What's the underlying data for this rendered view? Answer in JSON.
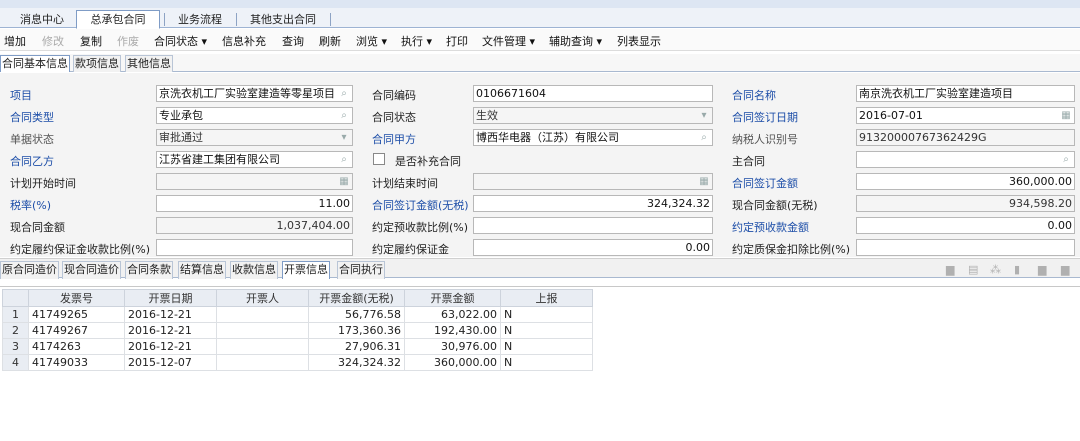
{
  "top_tabs": [
    "消息中心",
    "总承包合同",
    "业务流程",
    "其他支出合同"
  ],
  "toolbar": {
    "add": "增加",
    "edit": "修改",
    "copy": "复制",
    "void": "作废",
    "contract_status": "合同状态 ▾",
    "info_supplement": "信息补充",
    "query": "查询",
    "refresh": "刷新",
    "browse": "浏览 ▾",
    "execute": "执行 ▾",
    "print": "打印",
    "file_mgmt": "文件管理 ▾",
    "aux_query": "辅助查询 ▾",
    "list_view": "列表显示"
  },
  "sub_tabs": [
    "合同基本信息",
    "款项信息",
    "其他信息"
  ],
  "form": {
    "project_label": "项目",
    "project_value": "京洗衣机工厂实验室建造等零星项目",
    "contract_no_label": "合同编码",
    "contract_no_value": "0106671604",
    "contract_name_label": "合同名称",
    "contract_name_value": "南京洗衣机工厂实验室建造项目",
    "contract_type_label": "合同类型",
    "contract_type_value": "专业承包",
    "contract_status_label": "合同状态",
    "contract_status_value": "生效",
    "sign_date_label": "合同签订日期",
    "sign_date_value": "2016-07-01",
    "doc_status_label": "单据状态",
    "doc_status_value": "审批通过",
    "party_a_label": "合同甲方",
    "party_a_value": "博西华电器（江苏）有限公司",
    "taxpayer_id_label": "纳税人识别号",
    "taxpayer_id_value": "91320000767362429G",
    "party_b_label": "合同乙方",
    "party_b_value": "江苏省建工集团有限公司",
    "supplement_label": "是否补充合同",
    "main_contract_label": "主合同",
    "main_contract_value": "",
    "plan_start_label": "计划开始时间",
    "plan_start_value": "",
    "plan_end_label": "计划结束时间",
    "plan_end_value": "",
    "sign_amount_label": "合同签订金额",
    "sign_amount_value": "360,000.00",
    "tax_rate_label": "税率(%)",
    "tax_rate_value": "11.00",
    "sign_amount_notax_label": "合同签订金额(无税)",
    "sign_amount_notax_value": "324,324.32",
    "current_amount_notax_label": "现合同金额(无税)",
    "current_amount_notax_value": "934,598.20",
    "current_amount_label": "现合同金额",
    "current_amount_value": "1,037,404.00",
    "prepay_ratio_label": "约定预收款比例(%)",
    "prepay_ratio_value": "",
    "prepay_amount_label": "约定预收款金额",
    "prepay_amount_value": "0.00",
    "perf_bond_ratio_label": "约定履约保证金收款比例(%)",
    "perf_bond_ratio_value": "",
    "perf_bond_label": "约定履约保证金",
    "perf_bond_value": "0.00",
    "quality_bond_ratio_label": "约定质保金扣除比例(%)",
    "quality_bond_ratio_value": ""
  },
  "bottom_tabs": [
    "原合同造价",
    "现合同造价",
    "合同条款",
    "结算信息",
    "收款信息",
    "开票信息",
    "合同执行"
  ],
  "invoice_table": {
    "headers": [
      "发票号",
      "开票日期",
      "开票人",
      "开票金额(无税)",
      "开票金额",
      "上报"
    ],
    "rows": [
      [
        "1",
        "41749265",
        "2016-12-21",
        "",
        "56,776.58",
        "63,022.00",
        "N"
      ],
      [
        "2",
        "41749267",
        "2016-12-21",
        "",
        "173,360.36",
        "192,430.00",
        "N"
      ],
      [
        "3",
        "4174263",
        "2016-12-21",
        "",
        "27,906.31",
        "30,976.00",
        "N"
      ],
      [
        "4",
        "41749033",
        "2015-12-07",
        "",
        "324,324.32",
        "360,000.00",
        "N"
      ]
    ]
  }
}
